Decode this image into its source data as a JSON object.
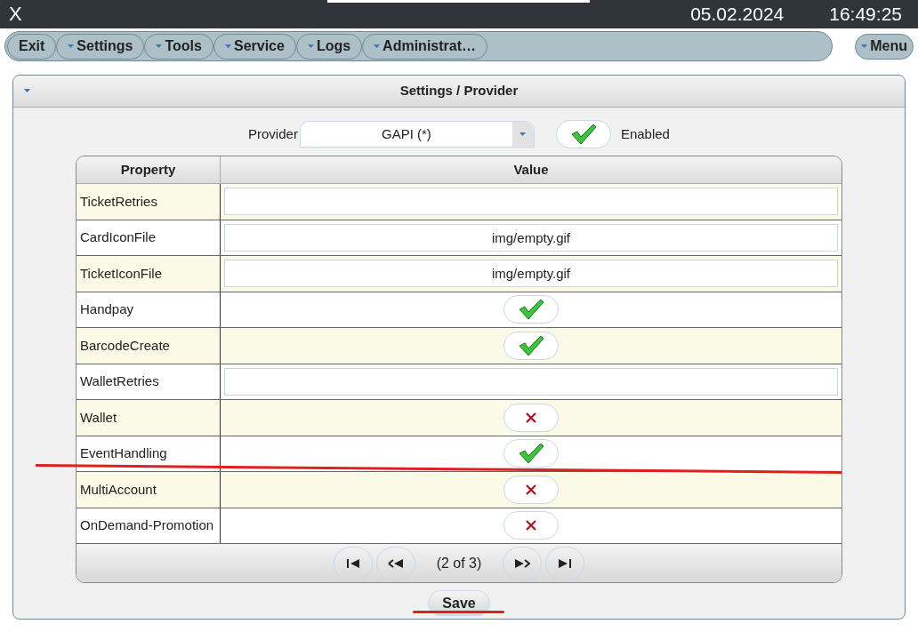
{
  "topbar": {
    "close": "X",
    "date": "05.02.2024",
    "time": "16:49:25"
  },
  "menu": [
    {
      "label": "Exit",
      "dropdown": false
    },
    {
      "label": "Settings",
      "dropdown": true
    },
    {
      "label": "Tools",
      "dropdown": true
    },
    {
      "label": "Service",
      "dropdown": true
    },
    {
      "label": "Logs",
      "dropdown": true
    },
    {
      "label": "Administrat…",
      "dropdown": true
    }
  ],
  "menu_button": "Menu",
  "panel": {
    "title": "Settings / Provider"
  },
  "provider": {
    "label": "Provider",
    "value": "GAPI (*)",
    "enabled": true,
    "enabled_label": "Enabled"
  },
  "table": {
    "columns": [
      "Property",
      "Value"
    ],
    "rows": [
      {
        "property": "TicketRetries",
        "kind": "text",
        "value": ""
      },
      {
        "property": "CardIconFile",
        "kind": "text",
        "value": "img/empty.gif"
      },
      {
        "property": "TicketIconFile",
        "kind": "text",
        "value": "img/empty.gif"
      },
      {
        "property": "Handpay",
        "kind": "toggle",
        "checked": true
      },
      {
        "property": "BarcodeCreate",
        "kind": "toggle",
        "checked": true
      },
      {
        "property": "WalletRetries",
        "kind": "text",
        "value": ""
      },
      {
        "property": "Wallet",
        "kind": "toggle",
        "checked": false
      },
      {
        "property": "EventHandling",
        "kind": "toggle",
        "checked": true
      },
      {
        "property": "MultiAccount",
        "kind": "toggle",
        "checked": false
      },
      {
        "property": "OnDemand-Promotion",
        "kind": "toggle",
        "checked": false
      }
    ]
  },
  "pager": {
    "page": "(2 of 3)"
  },
  "save": "Save"
}
